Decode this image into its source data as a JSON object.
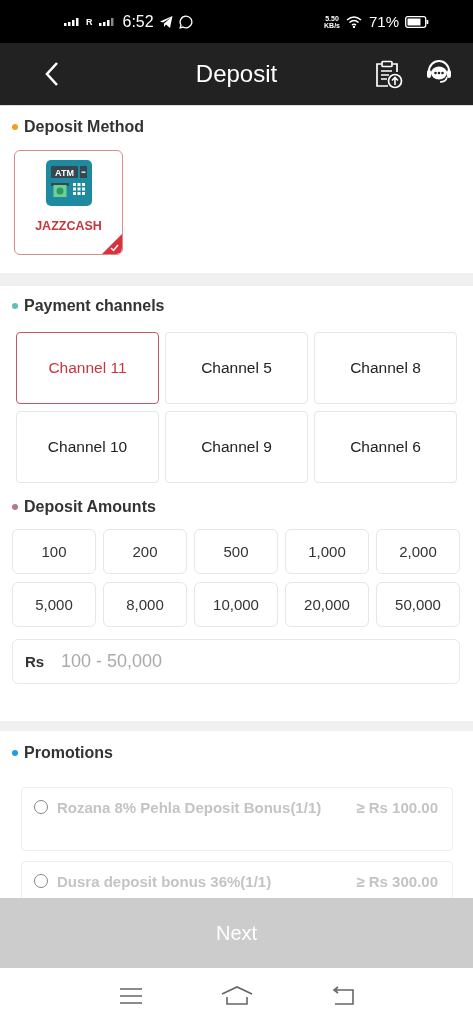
{
  "status_bar": {
    "carrier": "R",
    "time": "6:52",
    "speed": "5.50",
    "speed_unit": "KB/s",
    "battery": "71%"
  },
  "header": {
    "title": "Deposit"
  },
  "deposit_method": {
    "title": "Deposit Method",
    "methods": [
      {
        "label": "JAZZCASH",
        "icon_label": "ATM",
        "selected": true
      }
    ]
  },
  "payment_channels": {
    "title": "Payment channels",
    "channels": [
      {
        "label": "Channel 11",
        "selected": true
      },
      {
        "label": "Channel 5",
        "selected": false
      },
      {
        "label": "Channel 8",
        "selected": false
      },
      {
        "label": "Channel 10",
        "selected": false
      },
      {
        "label": "Channel 9",
        "selected": false
      },
      {
        "label": "Channel 6",
        "selected": false
      }
    ]
  },
  "deposit_amounts": {
    "title": "Deposit Amounts",
    "amounts": [
      "100",
      "200",
      "500",
      "1,000",
      "2,000",
      "5,000",
      "8,000",
      "10,000",
      "20,000",
      "50,000"
    ],
    "currency": "Rs",
    "placeholder": "100 - 50,000"
  },
  "promotions": {
    "title": "Promotions",
    "items": [
      {
        "name": "Rozana 8% Pehla Deposit Bonus(1/1)",
        "minimum": "≥ Rs 100.00",
        "selected": false
      },
      {
        "name": "Dusra deposit bonus 36%(1/1)",
        "minimum": "≥ Rs 300.00",
        "selected": false
      }
    ]
  },
  "next_button": {
    "label": "Next",
    "disabled": true
  }
}
